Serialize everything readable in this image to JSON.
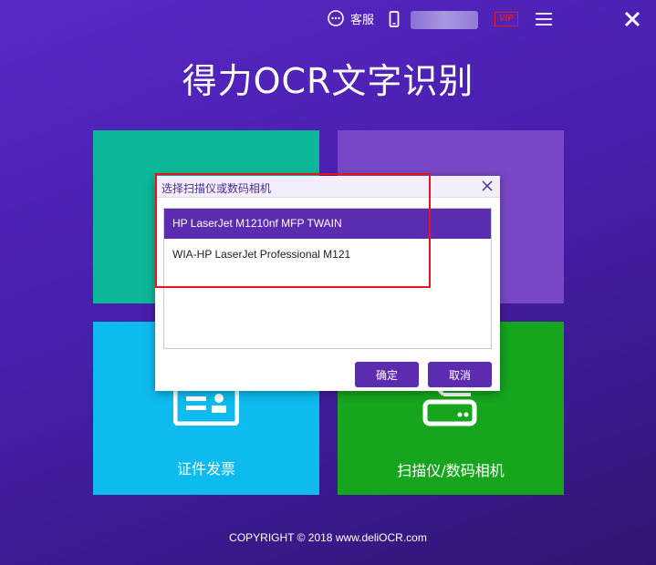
{
  "topbar": {
    "service_label": "客服",
    "icons": [
      "chat-icon",
      "phone-icon",
      "vip-icon",
      "menu-icon",
      "close-icon"
    ],
    "vip_label": "VIP"
  },
  "app": {
    "title": "得力OCR文字识别"
  },
  "tiles": [
    {
      "label": "",
      "color": "#0db89a"
    },
    {
      "label": "",
      "color": "#7848c8"
    },
    {
      "label": "证件发票",
      "color": "#0dbbef",
      "icon": "id-card-icon"
    },
    {
      "label": "扫描仪/数码相机",
      "color": "#16a51d",
      "icon": "scanner-icon"
    }
  ],
  "dialog": {
    "title": "选择扫描仪或数码相机",
    "devices": [
      "HP LaserJet M1210nf MFP TWAIN",
      "WIA-HP LaserJet Professional M121"
    ],
    "selected_index": 0,
    "ok_label": "确定",
    "cancel_label": "取消"
  },
  "footer": {
    "copyright": "COPYRIGHT © 2018  www.deliOCR.com"
  },
  "colors": {
    "accent": "#5b2bb0",
    "highlight": "#e8141b"
  }
}
